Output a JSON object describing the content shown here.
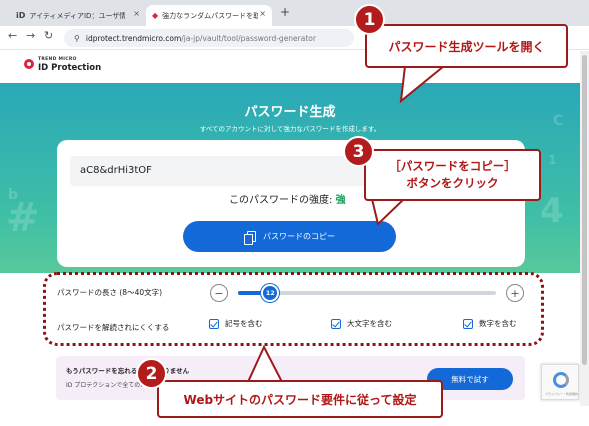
{
  "browser": {
    "tabs": [
      {
        "label": "アイティメディアID：ユーザ情報登録",
        "favicon": "iD",
        "active": false
      },
      {
        "label": "強力なランダムパスワードを取得 | ID Protection",
        "favicon": "shield",
        "active": true
      }
    ],
    "close_glyph": "×",
    "newtab_glyph": "+",
    "url_host": "idprotect.trendmicro.com",
    "url_path": "/ja-jp/vault/tool/password-generator"
  },
  "site": {
    "logo_small": "TREND MICRO",
    "logo_big": "ID Protection"
  },
  "hero": {
    "title": "パスワード生成",
    "subtitle": "すべてのアカウントに対して強力なパスワードを作成します。",
    "decor_chars": [
      "#",
      "b",
      "C",
      "4",
      "1"
    ]
  },
  "generator": {
    "password": "aC8&drHi3tOF",
    "strength_label": "このパスワードの強度:",
    "strength_value": "強",
    "copy_label": "パスワードのコピー"
  },
  "settings": {
    "length_label": "パスワードの長さ (8〜40文字)",
    "length_value": 12,
    "length_min": 8,
    "length_max": 40,
    "minus": "−",
    "plus": "+",
    "hard_label": "パスワードを解読されにくくする",
    "options": [
      {
        "label": "記号を含む",
        "checked": true
      },
      {
        "label": "大文字を含む",
        "checked": true
      },
      {
        "label": "数字を含む",
        "checked": true
      }
    ]
  },
  "promo": {
    "line1": "もうパスワードを忘れることはありません",
    "line2": "ID プロテクションで全てのパスワードを",
    "button": "無料で試す"
  },
  "recaptcha": {
    "text": "プライバシー・利用規約"
  },
  "callouts": [
    {
      "number": "1",
      "text": "パスワード生成ツールを開く"
    },
    {
      "number": "3",
      "text_line1": "［パスワードをコピー］",
      "text_line2": "ボタンをクリック"
    },
    {
      "number": "2",
      "text": "Webサイトのパスワード要件に従って設定"
    }
  ],
  "colors": {
    "accent": "#1469d8",
    "callout_red": "#b11616",
    "strength_green": "#18a058",
    "hero_teal": "#2aa8b8"
  }
}
